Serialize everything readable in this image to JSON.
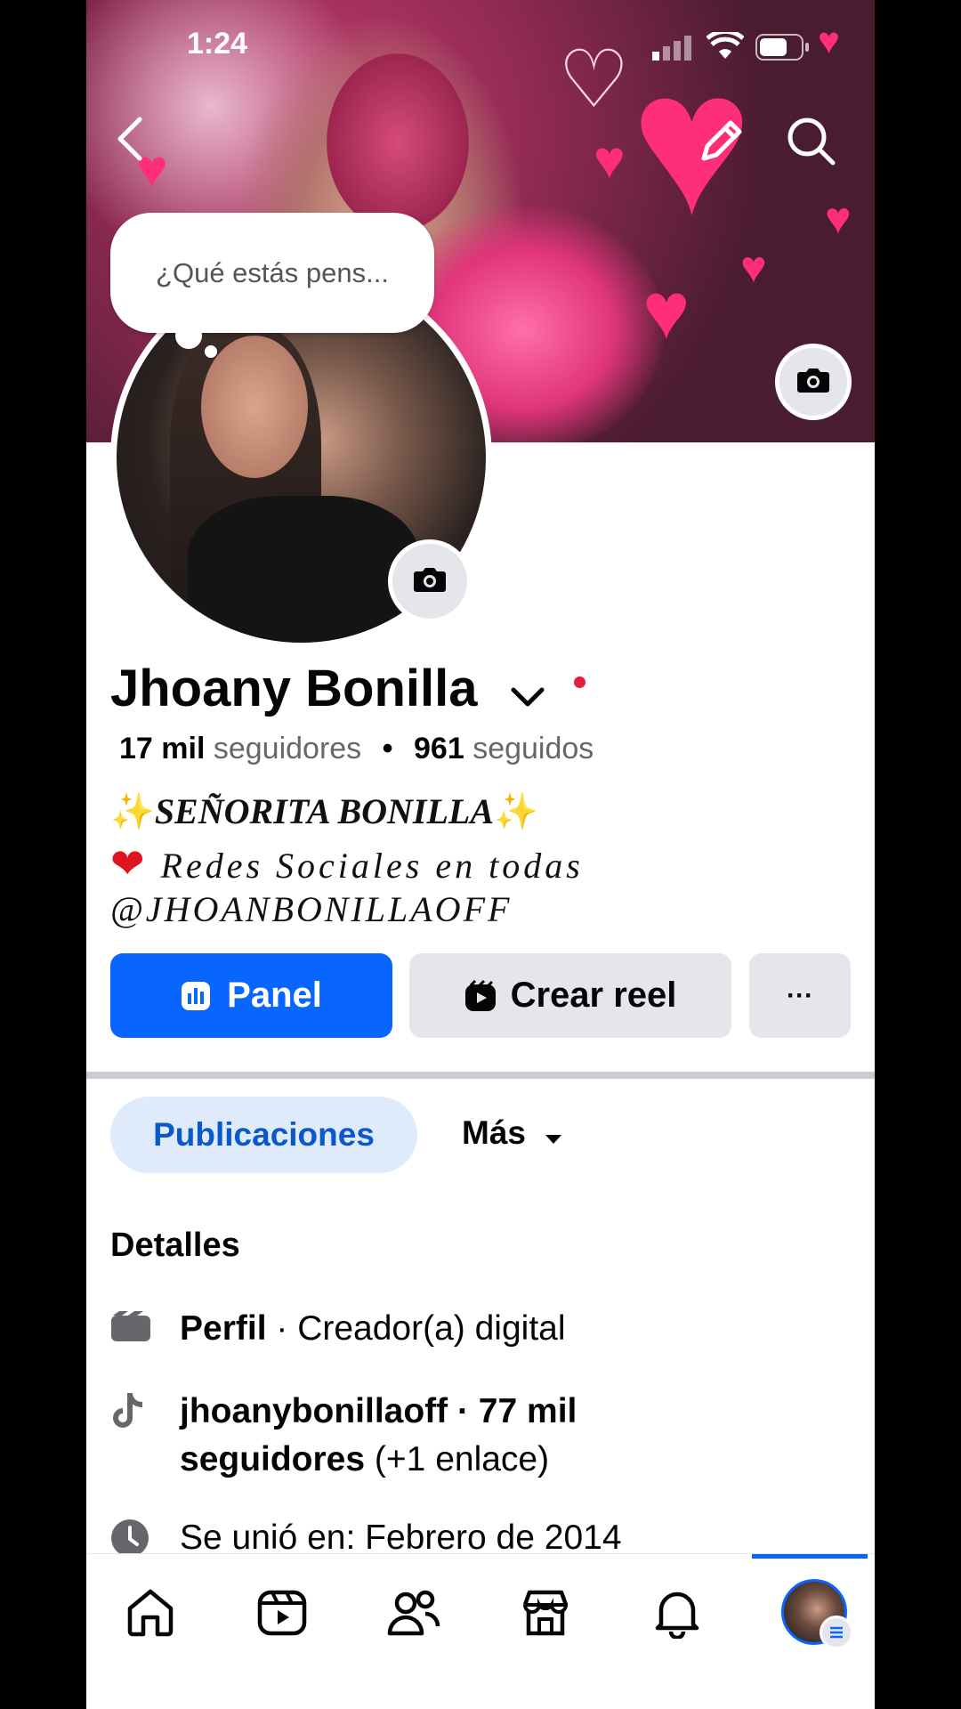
{
  "status_bar": {
    "time": "1:24"
  },
  "composer": {
    "placeholder": "¿Qué estás pens..."
  },
  "profile": {
    "name": "Jhoany Bonilla",
    "followers_count": "17 mil",
    "followers_label": "seguidores",
    "following_count": "961",
    "following_label": "seguidos",
    "bio": {
      "line1": "SEÑORITA BONILLA",
      "line2": "Redes Sociales en todas",
      "line3": "@JHOANBONILLAOFF"
    }
  },
  "actions": {
    "panel_label": "Panel",
    "reel_label": "Crear reel",
    "more_label": "···"
  },
  "tabs": {
    "posts_label": "Publicaciones",
    "more_label": "Más"
  },
  "details": {
    "title": "Detalles",
    "profile_bold": "Perfil",
    "profile_rest": " · Creador(a) digital",
    "tiktok_bold": "jhoanybonillaoff · 77 mil seguidores",
    "tiktok_rest": " (+1 enlace)",
    "joined": "Se unió en: Febrero de 2014"
  },
  "colors": {
    "primary": "#0866ff",
    "tab_active_bg": "#dfeafb",
    "notification_dot": "#e41e3f"
  },
  "icons": [
    "back-icon",
    "edit-icon",
    "search-icon",
    "camera-icon",
    "chevron-down-icon",
    "panel-icon",
    "reel-icon",
    "film-icon",
    "tiktok-icon",
    "clock-icon",
    "home-icon",
    "video-icon",
    "friends-icon",
    "marketplace-icon",
    "bell-icon",
    "avatar"
  ]
}
